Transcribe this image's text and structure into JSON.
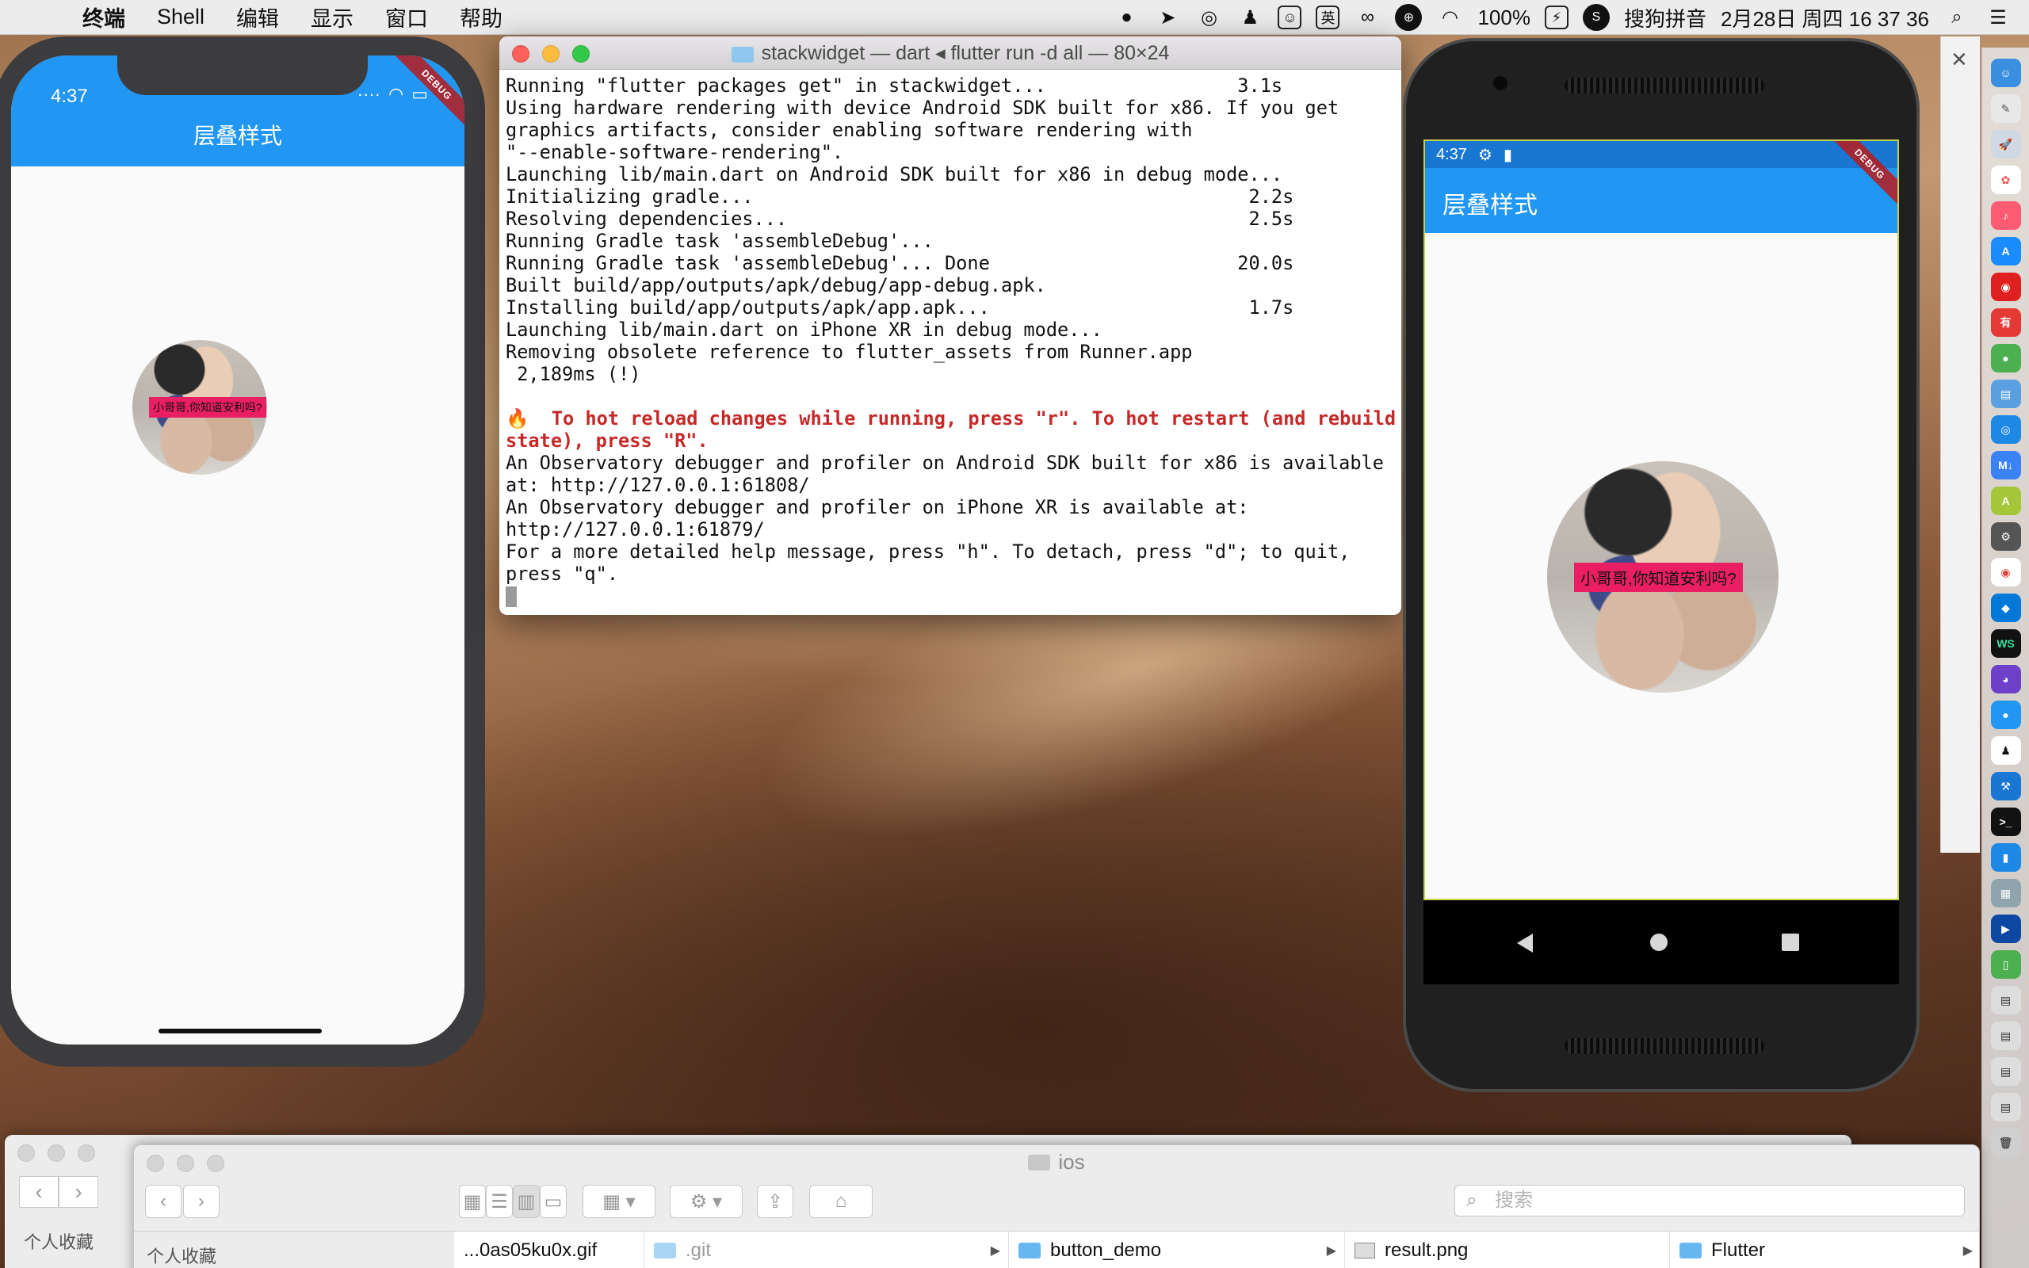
{
  "menubar": {
    "apple": "",
    "items": [
      "终端",
      "Shell",
      "编辑",
      "显示",
      "窗口",
      "帮助"
    ],
    "battery": "100%",
    "ime_label": "搜狗拼音",
    "ime_lang": "英",
    "datetime": "2月28日 周四  16 37 36"
  },
  "iphone": {
    "time": "4:37",
    "title": "层叠样式",
    "debug": "DEBUG",
    "avatar_label": "小哥哥,你知道安利吗?"
  },
  "terminal": {
    "title": "stackwidget — dart ◂ flutter run -d all — 80×24",
    "lines": [
      "Running \"flutter packages get\" in stackwidget...                 3.1s",
      "Using hardware rendering with device Android SDK built for x86. If you get",
      "graphics artifacts, consider enabling software rendering with",
      "\"--enable-software-rendering\".",
      "Launching lib/main.dart on Android SDK built for x86 in debug mode...",
      "Initializing gradle...                                            2.2s",
      "Resolving dependencies...                                         2.5s",
      "Running Gradle task 'assembleDebug'...",
      "Running Gradle task 'assembleDebug'... Done                      20.0s",
      "Built build/app/outputs/apk/debug/app-debug.apk.",
      "Installing build/app/outputs/apk/app.apk...                       1.7s",
      "Launching lib/main.dart on iPhone XR in debug mode...",
      "Removing obsolete reference to flutter_assets from Runner.app",
      " 2,189ms (!)",
      ""
    ],
    "hot_line_1": "🔥  To hot reload changes while running, press \"r\". To hot restart (and rebuild",
    "hot_line_2": "state), press \"R\".",
    "tail_lines": [
      "An Observatory debugger and profiler on Android SDK built for x86 is available",
      "at: http://127.0.0.1:61808/",
      "An Observatory debugger and profiler on iPhone XR is available at:",
      "http://127.0.0.1:61879/",
      "For a more detailed help message, press \"h\". To detach, press \"d\"; to quit,",
      "press \"q\"."
    ]
  },
  "android": {
    "time": "4:37",
    "title": "层叠样式",
    "debug": "DEBUG",
    "avatar_label": "小哥哥,你知道安利吗?"
  },
  "finder_back": {
    "sidebar_heading": "个人收藏"
  },
  "finder": {
    "title": "ios",
    "sidebar_heading": "个人收藏",
    "search_placeholder": "搜索",
    "columns": [
      {
        "name": "...0as05ku0x.gif"
      },
      {
        "name": ".git"
      },
      {
        "name": "button_demo"
      },
      {
        "name": "result.png"
      },
      {
        "name": "Flutter"
      }
    ]
  },
  "colors": {
    "flutter_blue": "#2196f3",
    "android_status": "#1976d2",
    "label_pink": "#e91e63",
    "terminal_hot": "#c62828"
  }
}
